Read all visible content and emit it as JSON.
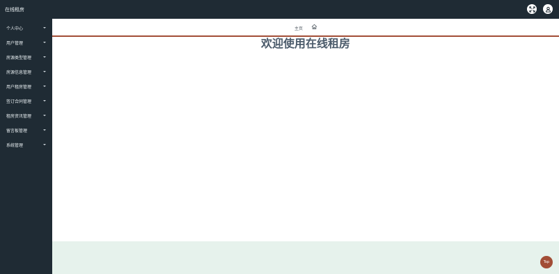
{
  "header": {
    "app_title": "在线租房",
    "fullscreen_icon": "fullscreen-icon",
    "user_icon": "user-icon"
  },
  "sidebar": {
    "items": [
      {
        "label": "个人中心"
      },
      {
        "label": "用户管理"
      },
      {
        "label": "房源类型管理"
      },
      {
        "label": "房源信息管理"
      },
      {
        "label": "用户租房管理"
      },
      {
        "label": "签订合同管理"
      },
      {
        "label": "租房资讯管理"
      },
      {
        "label": "留言板管理"
      },
      {
        "label": "系统管理"
      }
    ]
  },
  "breadcrumb": {
    "home_label": "主页",
    "home_icon": "home-icon"
  },
  "main": {
    "welcome_text": "欢迎使用在线租房"
  },
  "back_to_top": {
    "label": "Top"
  },
  "colors": {
    "sidebar_bg": "#1f2b34",
    "accent": "#a24d36",
    "footer_bg": "#e6f2ec",
    "title_text": "#4a5a6a"
  }
}
